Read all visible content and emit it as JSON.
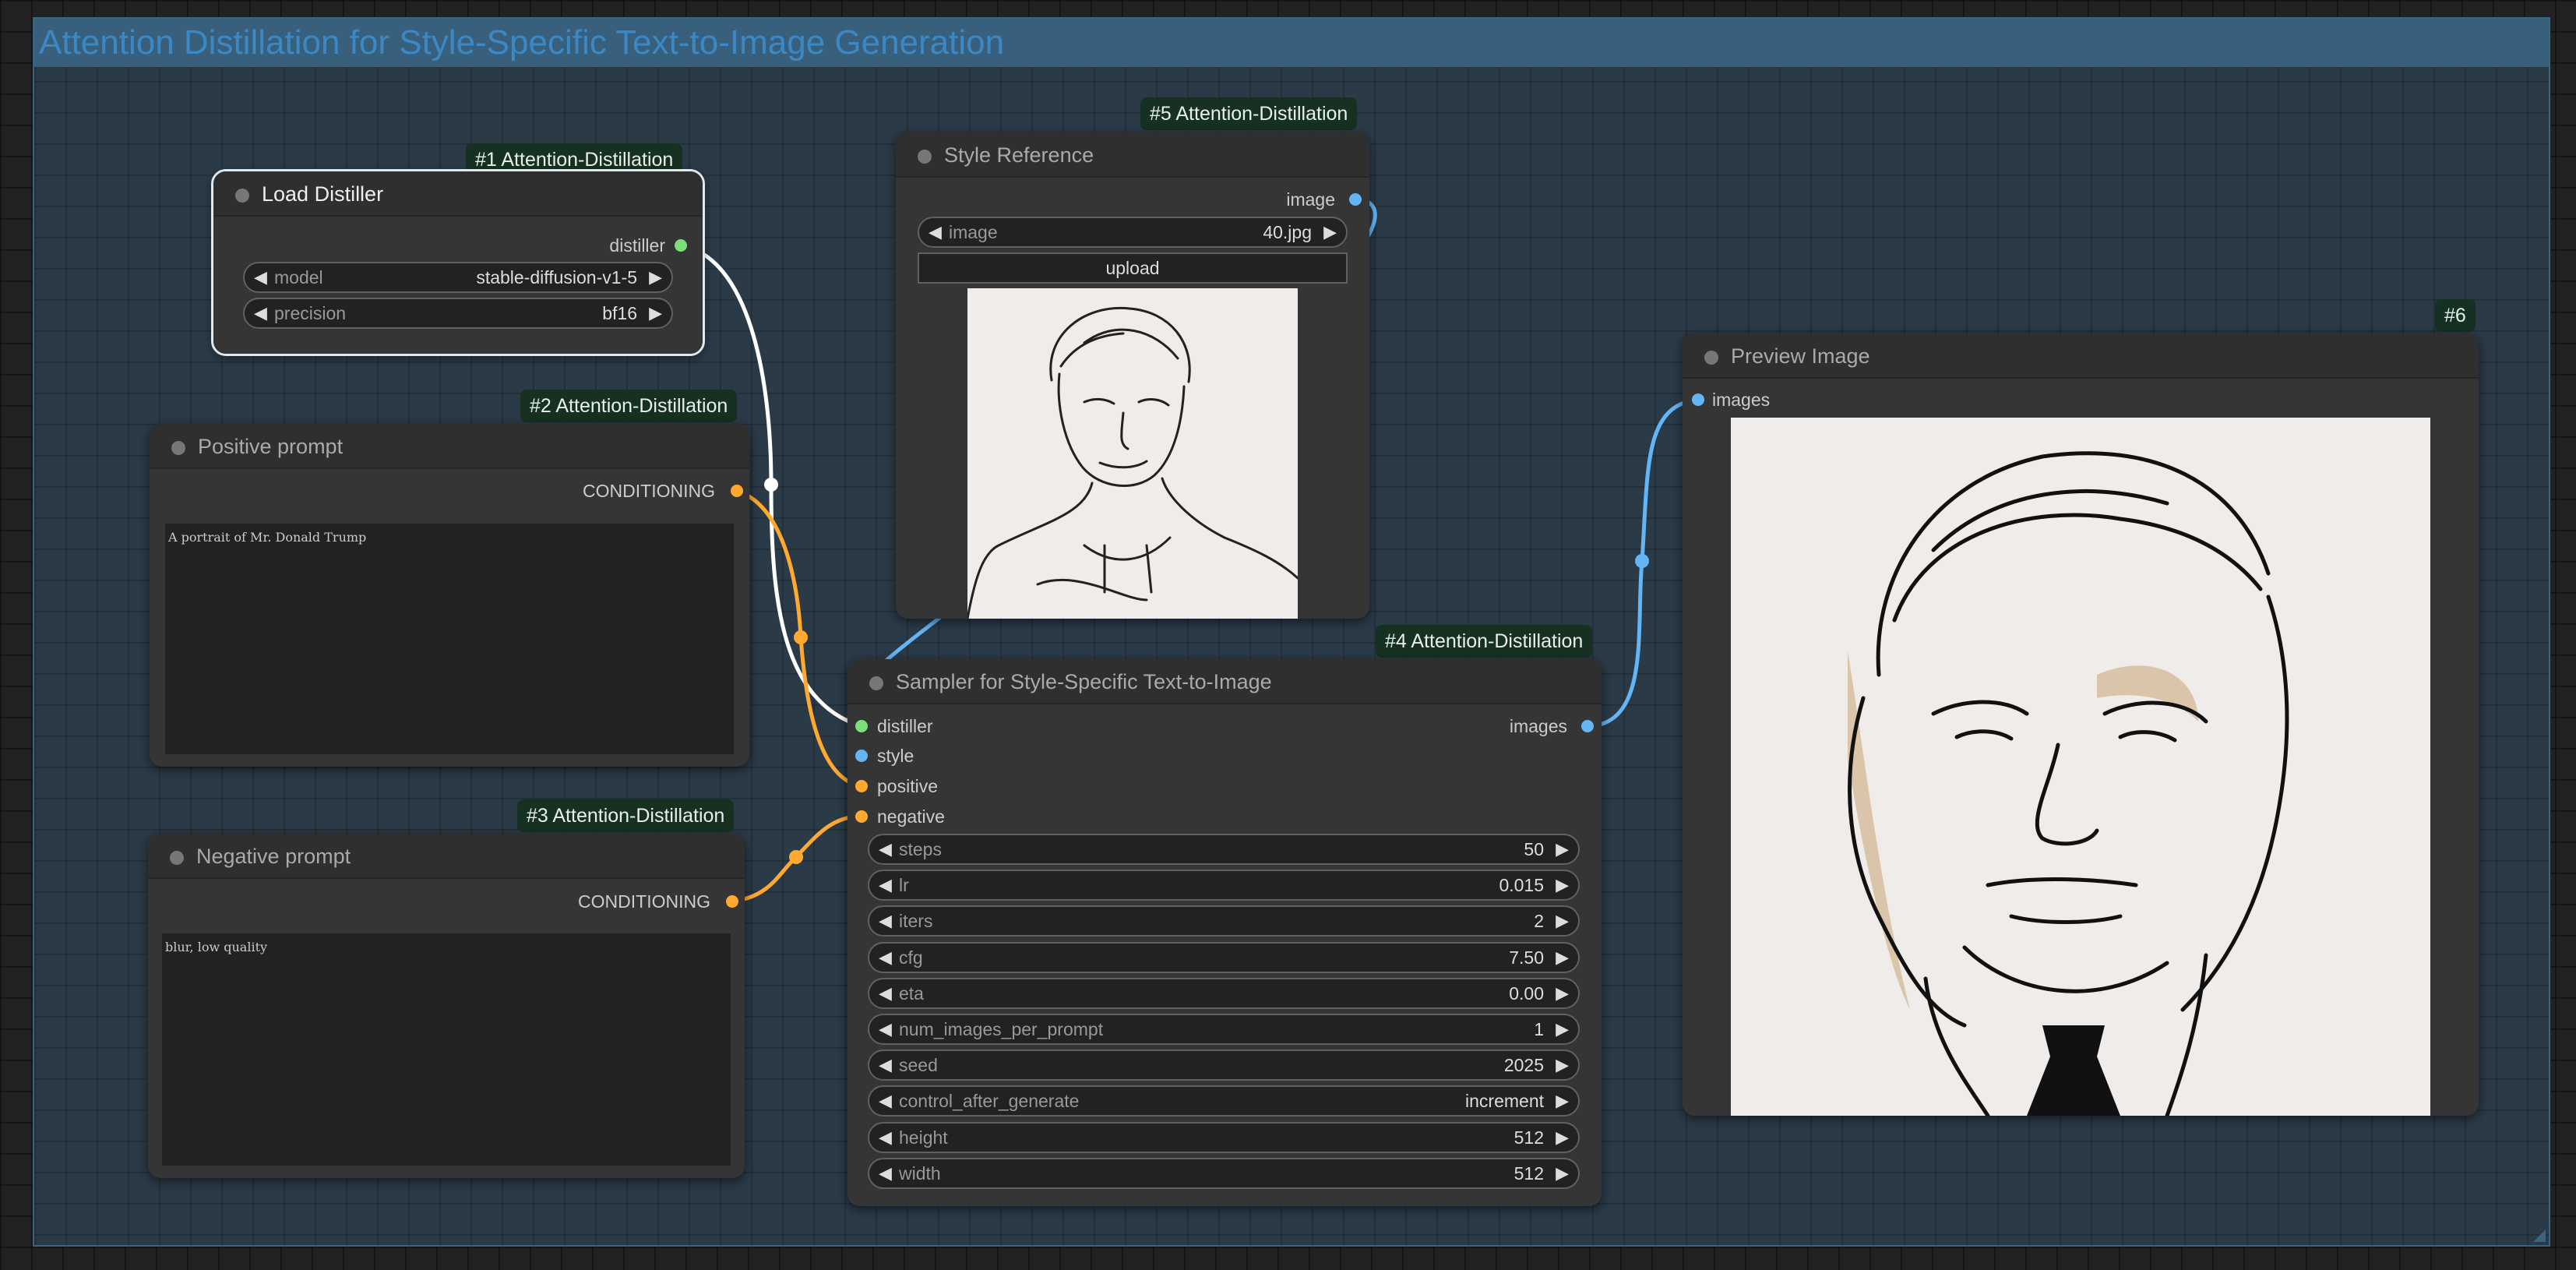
{
  "group": {
    "title": "Attention Distillation for Style-Specific Text-to-Image Generation"
  },
  "nodes": {
    "load_distiller": {
      "badge": "#1 Attention-Distillation",
      "title": "Load Distiller",
      "output": "distiller",
      "widgets": [
        {
          "label": "model",
          "value": "stable-diffusion-v1-5"
        },
        {
          "label": "precision",
          "value": "bf16"
        }
      ]
    },
    "positive_prompt": {
      "badge": "#2 Attention-Distillation",
      "title": "Positive prompt",
      "output": "CONDITIONING",
      "text": "A portrait of Mr. Donald Trump"
    },
    "negative_prompt": {
      "badge": "#3 Attention-Distillation",
      "title": "Negative prompt",
      "output": "CONDITIONING",
      "text": "blur, low quality"
    },
    "sampler": {
      "badge": "#4 Attention-Distillation",
      "title": "Sampler for Style-Specific Text-to-Image",
      "inputs": [
        "distiller",
        "style",
        "positive",
        "negative"
      ],
      "output": "images",
      "widgets": [
        {
          "label": "steps",
          "value": "50"
        },
        {
          "label": "lr",
          "value": "0.015"
        },
        {
          "label": "iters",
          "value": "2"
        },
        {
          "label": "cfg",
          "value": "7.50"
        },
        {
          "label": "eta",
          "value": "0.00"
        },
        {
          "label": "num_images_per_prompt",
          "value": "1"
        },
        {
          "label": "seed",
          "value": "2025"
        },
        {
          "label": "control_after_generate",
          "value": "increment"
        },
        {
          "label": "height",
          "value": "512"
        },
        {
          "label": "width",
          "value": "512"
        }
      ]
    },
    "style_reference": {
      "badge": "#5 Attention-Distillation",
      "title": "Style Reference",
      "output": "image",
      "widgets": [
        {
          "label": "image",
          "value": "40.jpg"
        }
      ],
      "upload_label": "upload"
    },
    "preview_image": {
      "badge": "#6",
      "title": "Preview Image",
      "input": "images"
    }
  },
  "colors": {
    "distiller": "#7be07b",
    "image": "#64b5f6",
    "conditioning": "#ffa931",
    "distiller_wire": "#ffffff",
    "group_bg": "#2b3a47",
    "group_header": "#38607d"
  },
  "icons": {
    "arrow_left": "◀",
    "arrow_right": "▶"
  }
}
